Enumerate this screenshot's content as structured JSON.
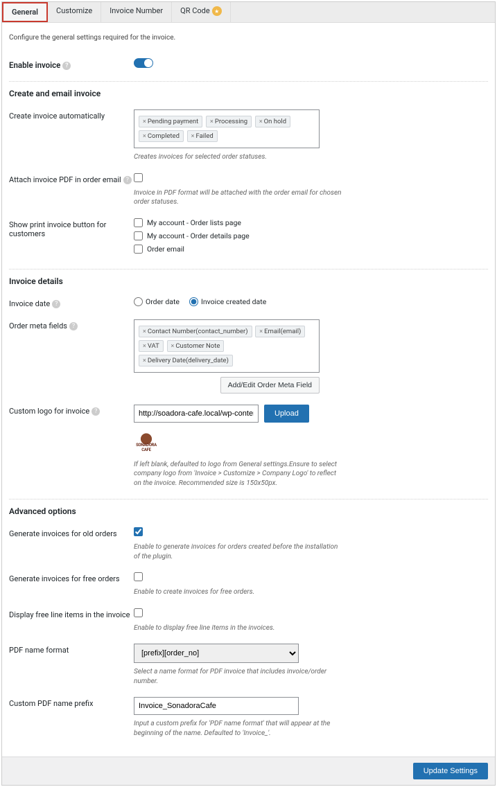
{
  "tabs": {
    "general": "General",
    "customize": "Customize",
    "invoice_number": "Invoice Number",
    "qr_code": "QR Code"
  },
  "intro": "Configure the general settings required for the invoice.",
  "enable_invoice_label": "Enable invoice",
  "section_create": "Create and email invoice",
  "create_auto_label": "Create invoice automatically",
  "create_auto_tags": [
    "Pending payment",
    "Processing",
    "On hold",
    "Completed",
    "Failed"
  ],
  "create_auto_desc": "Creates invoices for selected order statuses.",
  "attach_pdf_label": "Attach invoice PDF in order email",
  "attach_pdf_desc": "Invoice in PDF format will be attached with the order email for chosen order statuses.",
  "print_btn_label": "Show print invoice button for customers",
  "print_opts": {
    "lists": "My account - Order lists page",
    "details": "My account - Order details page",
    "email": "Order email"
  },
  "section_details": "Invoice details",
  "invoice_date_label": "Invoice date",
  "invoice_date_opts": {
    "order": "Order date",
    "created": "Invoice created date"
  },
  "order_meta_label": "Order meta fields",
  "order_meta_tags": [
    "Contact Number(contact_number)",
    "Email(email)",
    "VAT",
    "Customer Note",
    "Delivery Date(delivery_date)"
  ],
  "order_meta_btn": "Add/Edit Order Meta Field",
  "custom_logo_label": "Custom logo for invoice",
  "custom_logo_url": "http://soadora-cafe.local/wp-content/up",
  "upload_btn": "Upload",
  "custom_logo_desc": "If left blank, defaulted to logo from General settings.Ensure to select company logo from 'Invoice > Customize > Company Logo' to reflect on the invoice. Recommended size is 150x50px.",
  "logo_text": "SONADORA CAFE",
  "section_advanced": "Advanced options",
  "gen_old_label": "Generate invoices for old orders",
  "gen_old_desc": "Enable to generate invoices for orders created before the installation of the plugin.",
  "gen_free_label": "Generate invoices for free orders",
  "gen_free_desc": "Enable to create invoices for free orders.",
  "disp_free_label": "Display free line items in the invoice",
  "disp_free_desc": "Enable to display free line items in the invoices.",
  "pdf_name_label": "PDF name format",
  "pdf_name_value": "[prefix][order_no]",
  "pdf_name_desc": "Select a name format for PDF invoice that includes invoice/order number.",
  "pdf_prefix_label": "Custom PDF name prefix",
  "pdf_prefix_value": "Invoice_SonadoraCafe",
  "pdf_prefix_desc": "Input a custom prefix for 'PDF name format' that will appear at the beginning of the name. Defaulted to 'Invoice_'.",
  "update_btn": "Update Settings"
}
